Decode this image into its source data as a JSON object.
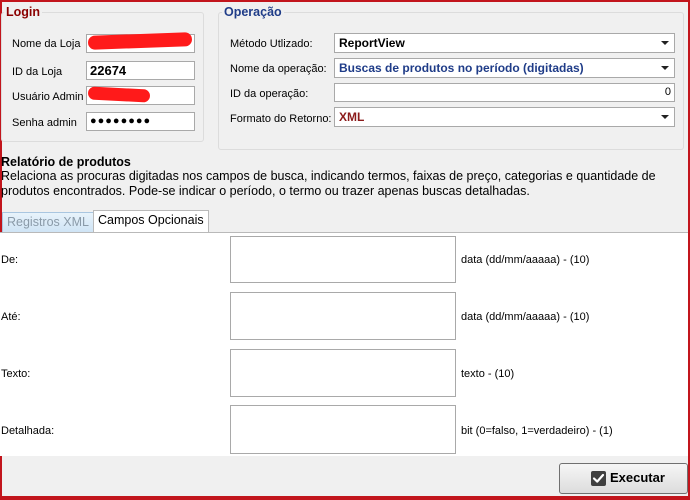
{
  "login": {
    "title": "Login",
    "store_name_label": "Nome da Loja",
    "store_name_value": "",
    "store_id_label": "ID da Loja",
    "store_id_value": "22674",
    "admin_user_label": "Usuário Admin",
    "admin_user_value": "",
    "admin_password_label": "Senha admin",
    "admin_password_value": "●●●●●●●●"
  },
  "operation": {
    "title": "Operação",
    "method_label": "Método Utlizado:",
    "method_value": "ReportView",
    "op_name_label": "Nome da operação:",
    "op_name_value": "Buscas de produtos no período (digitadas)",
    "op_id_label": "ID da operação:",
    "op_id_value": "0",
    "return_format_label": "Formato do Retorno:",
    "return_format_value": "XML"
  },
  "report": {
    "title": "Relatório de produtos",
    "description": "Relaciona as procuras digitadas nos campos de busca, indicando termos, faixas de preço, categorias e quantidade de produtos encontrados. Pode-se indicar o período, o termo ou trazer apenas buscas detalhadas."
  },
  "tabs": [
    {
      "label": "Registros XML"
    },
    {
      "label": "Campos Opcionais"
    }
  ],
  "fields": [
    {
      "label": "De:",
      "hint": "data (dd/mm/aaaaa) - (10)",
      "value": ""
    },
    {
      "label": "Até:",
      "hint": "data (dd/mm/aaaaa) - (10)",
      "value": ""
    },
    {
      "label": "Texto:",
      "hint": "texto - (10)",
      "value": ""
    },
    {
      "label": "Detalhada:",
      "hint": "bit (0=falso, 1=verdadeiro) - (1)",
      "value": ""
    }
  ],
  "actions": {
    "execute_label": "Executar"
  },
  "colors": {
    "login_title": "#8b0000",
    "operation_title": "#1f3c88",
    "return_format": "#8b1a1a",
    "redaction": "#ff1a1a",
    "window_border": "#c2151c"
  }
}
